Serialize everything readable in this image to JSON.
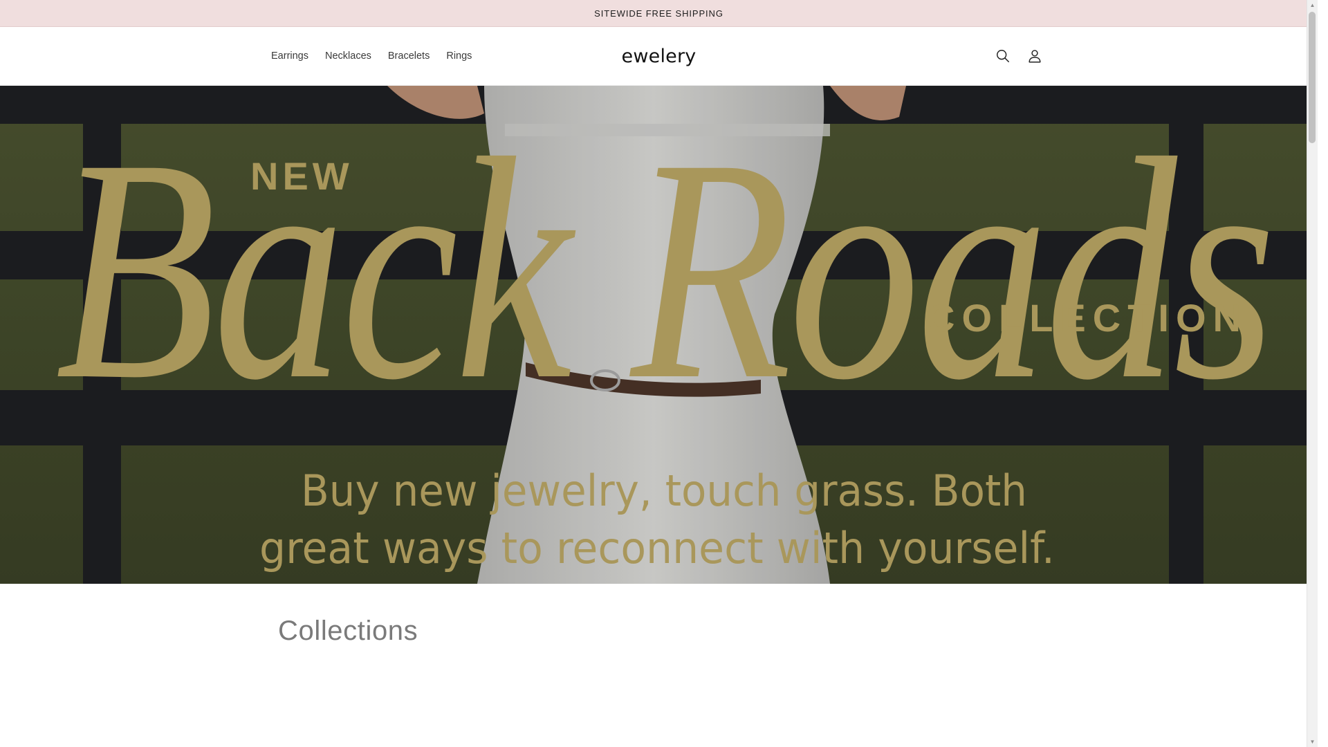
{
  "announcement": {
    "text": "SITEWIDE FREE SHIPPING"
  },
  "header": {
    "nav": [
      {
        "label": "Earrings"
      },
      {
        "label": "Necklaces"
      },
      {
        "label": "Bracelets"
      },
      {
        "label": "Rings"
      }
    ],
    "logo": "ewelery",
    "icons": [
      "search-icon",
      "account-icon"
    ]
  },
  "hero": {
    "kicker": "NEW",
    "title": "Back Roads",
    "subtitle": "COLLECTION",
    "tagline_line1": "Buy new jewelry, touch grass. Both",
    "tagline_line2": "great ways to reconnect with yourself.",
    "colors": {
      "gold": "#b8a463",
      "grass": "#4a5130",
      "fence": "#1f1f22",
      "dress": "#cfcfcd"
    }
  },
  "collections": {
    "heading": "Collections"
  },
  "colors": {
    "announcement_bg": "#f0dede",
    "text": "#121212",
    "muted_heading": "#7a7a7a"
  }
}
